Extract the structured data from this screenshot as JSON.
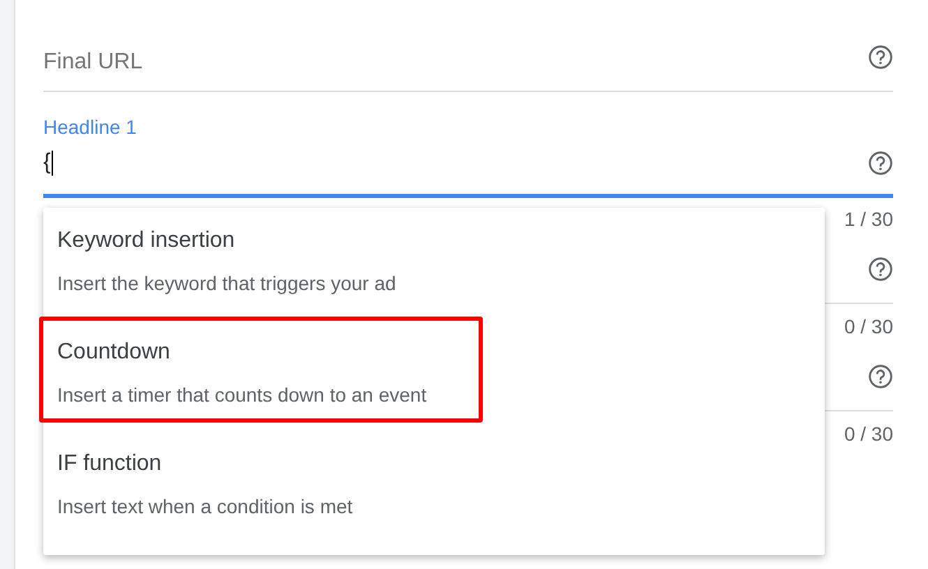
{
  "fields": [
    {
      "kind": "url",
      "placeholder": "Final URL",
      "help": true
    },
    {
      "kind": "headline",
      "label": "Headline 1",
      "value": "{",
      "focused": true,
      "help": true,
      "counter": "1 / 30"
    },
    {
      "kind": "hidden",
      "help": true,
      "counter": "0 / 30"
    },
    {
      "kind": "hidden",
      "help": true,
      "counter": "0 / 30"
    }
  ],
  "menu": {
    "items": [
      {
        "title": "Keyword insertion",
        "description": "Insert the keyword that triggers your ad",
        "highlighted": false
      },
      {
        "title": "Countdown",
        "description": "Insert a timer that counts down to an event",
        "highlighted": true
      },
      {
        "title": "IF function",
        "description": "Insert text when a condition is met",
        "highlighted": false
      }
    ]
  }
}
